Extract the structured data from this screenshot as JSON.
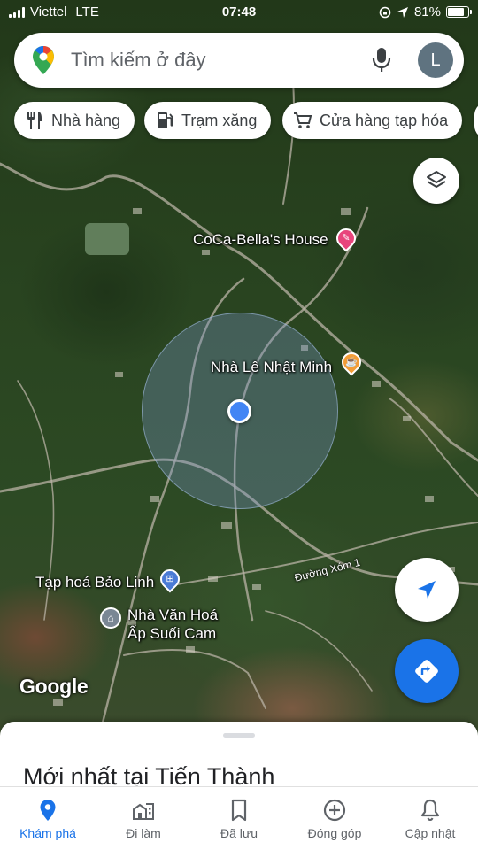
{
  "status_bar": {
    "carrier": "Viettel",
    "network": "LTE",
    "time": "07:48",
    "battery_percent": "81%",
    "battery_level": 0.81
  },
  "search": {
    "placeholder": "Tìm kiếm ở đây",
    "avatar_initial": "L"
  },
  "chips": [
    {
      "label": "Nhà hàng",
      "icon": "restaurant-icon"
    },
    {
      "label": "Trạm xăng",
      "icon": "gas-station-icon"
    },
    {
      "label": "Cửa hàng tạp hóa",
      "icon": "shopping-cart-icon"
    }
  ],
  "map": {
    "places": [
      {
        "name": "CoCa-Bella's House",
        "icon": "favorite-place-icon",
        "color": "#e8457c"
      },
      {
        "name": "Nhà Lê Nhật Minh",
        "icon": "cafe-icon",
        "color": "#f29d38"
      },
      {
        "name": "Tạp hoá Bảo Linh",
        "icon": "shopping-bag-icon",
        "color": "#4a7bd6"
      },
      {
        "name_line1": "Nhà Văn Hoá",
        "name_line2": "Ấp Suối Cam",
        "icon": "cultural-house-icon",
        "color": "#7a8794"
      }
    ],
    "roads": [
      {
        "name": "Đường Xóm 1"
      }
    ],
    "attribution": "Google"
  },
  "sheet": {
    "title": "Mới nhất tại Tiến Thành"
  },
  "nav": [
    {
      "label": "Khám phá",
      "icon": "explore-pin-icon",
      "active": true
    },
    {
      "label": "Đi làm",
      "icon": "commute-icon",
      "active": false
    },
    {
      "label": "Đã lưu",
      "icon": "bookmark-icon",
      "active": false
    },
    {
      "label": "Đóng góp",
      "icon": "add-circle-icon",
      "active": false
    },
    {
      "label": "Cập nhật",
      "icon": "bell-icon",
      "active": false
    }
  ],
  "colors": {
    "accent": "#1a73e8",
    "location_dot": "#4285f4"
  }
}
